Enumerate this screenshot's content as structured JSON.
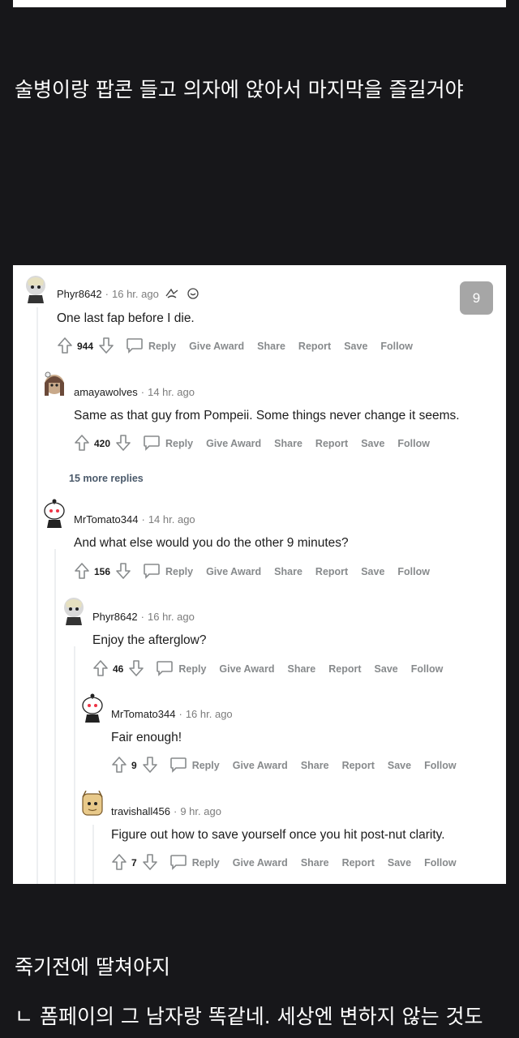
{
  "captions": {
    "top": "술병이랑 팝콘 들고 의자에 앉아서 마지막을 즐길거야",
    "bottom1": "죽기전에 딸쳐야지",
    "bottom2": "ㄴ 폼페이의 그 남자랑 똑같네. 세상엔 변하지 않는 것도"
  },
  "image_count_badge": "9",
  "actions": {
    "reply": "Reply",
    "give_award": "Give Award",
    "share": "Share",
    "report": "Report",
    "save": "Save",
    "follow": "Follow"
  },
  "comments": [
    {
      "user": "Phyr8642",
      "time": "16 hr. ago",
      "text": "One last fap before I die.",
      "score": "944"
    },
    {
      "user": "amayawolves",
      "time": "14 hr. ago",
      "text": "Same as that guy from Pompeii. Some things never change it seems.",
      "score": "420"
    },
    {
      "user": "MrTomato344",
      "time": "14 hr. ago",
      "text": "And what else would you do the other 9 minutes?",
      "score": "156"
    },
    {
      "user": "Phyr8642",
      "time": "16 hr. ago",
      "text": "Enjoy the afterglow?",
      "score": "46"
    },
    {
      "user": "MrTomato344",
      "time": "16 hr. ago",
      "text": "Fair enough!",
      "score": "9"
    },
    {
      "user": "travishall456",
      "time": "9 hr. ago",
      "text": "Figure out how to save yourself once you hit post-nut clarity.",
      "score": "7"
    }
  ],
  "more_replies": "15 more replies",
  "colors": {
    "page_bg": "#17171a",
    "card_bg": "#ffffff",
    "muted_text": "#878a8c",
    "body_text": "#1c1c1c"
  }
}
